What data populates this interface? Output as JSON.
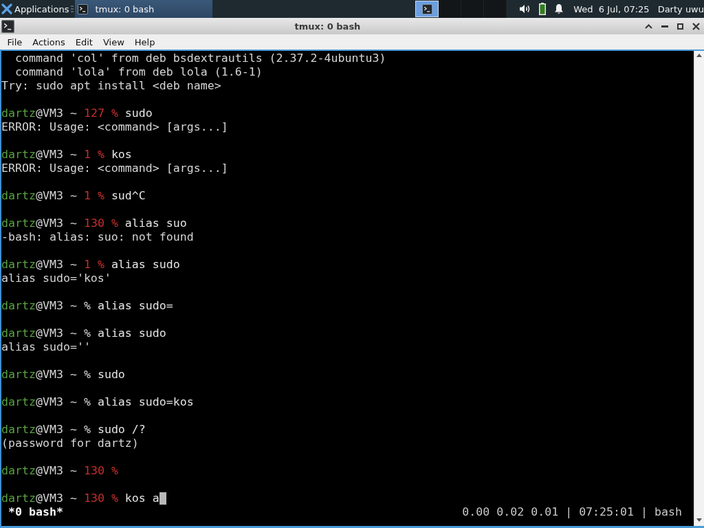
{
  "panel": {
    "applications_button": "Applications",
    "tasks": [
      {
        "label": "tmux: 0 bash",
        "selected": true
      }
    ],
    "workspaces": [
      {
        "selected": true,
        "has_window": true
      },
      {
        "selected": false,
        "has_window": false
      },
      {
        "selected": false,
        "has_window": false
      },
      {
        "selected": false,
        "has_window": false
      }
    ],
    "clock": "Wed  6 Jul, 07:25",
    "user": "Darty uwu"
  },
  "window": {
    "title": "tmux: 0 bash",
    "menu": [
      "File",
      "Actions",
      "Edit",
      "View",
      "Help"
    ]
  },
  "terminal": {
    "lines": [
      {
        "kind": "output",
        "text": "  command 'col' from deb bsdextrautils (2.37.2-4ubuntu3)"
      },
      {
        "kind": "output",
        "text": "  command 'lola' from deb lola (1.6-1)"
      },
      {
        "kind": "output",
        "text": "Try: sudo apt install <deb name>"
      },
      {
        "kind": "blank"
      },
      {
        "kind": "prompt",
        "user": "dartz",
        "host": "@VM3 ~",
        "exit_code": "127",
        "sign": "%",
        "command": "sudo",
        "cursor": false
      },
      {
        "kind": "output",
        "text": "ERROR: Usage: <command> [args...]"
      },
      {
        "kind": "blank"
      },
      {
        "kind": "prompt",
        "user": "dartz",
        "host": "@VM3 ~",
        "exit_code": "1",
        "sign": "%",
        "command": "kos",
        "cursor": false
      },
      {
        "kind": "output",
        "text": "ERROR: Usage: <command> [args...]"
      },
      {
        "kind": "blank"
      },
      {
        "kind": "prompt",
        "user": "dartz",
        "host": "@VM3 ~",
        "exit_code": "1",
        "sign": "%",
        "command": "sud^C",
        "cursor": false
      },
      {
        "kind": "blank"
      },
      {
        "kind": "prompt",
        "user": "dartz",
        "host": "@VM3 ~",
        "exit_code": "130",
        "sign": "%",
        "command": "alias suo",
        "cursor": false
      },
      {
        "kind": "output",
        "text": "-bash: alias: suo: not found"
      },
      {
        "kind": "blank"
      },
      {
        "kind": "prompt",
        "user": "dartz",
        "host": "@VM3 ~",
        "exit_code": "1",
        "sign": "%",
        "command": "alias sudo",
        "cursor": false
      },
      {
        "kind": "output",
        "text": "alias sudo='kos'"
      },
      {
        "kind": "blank"
      },
      {
        "kind": "prompt",
        "user": "dartz",
        "host": "@VM3 ~",
        "sign": "%",
        "command": "alias sudo=",
        "cursor": false
      },
      {
        "kind": "blank"
      },
      {
        "kind": "prompt",
        "user": "dartz",
        "host": "@VM3 ~",
        "sign": "%",
        "command": "alias sudo",
        "cursor": false
      },
      {
        "kind": "output",
        "text": "alias sudo=''"
      },
      {
        "kind": "blank"
      },
      {
        "kind": "prompt",
        "user": "dartz",
        "host": "@VM3 ~",
        "sign": "%",
        "command": "sudo",
        "cursor": false
      },
      {
        "kind": "blank"
      },
      {
        "kind": "prompt",
        "user": "dartz",
        "host": "@VM3 ~",
        "sign": "%",
        "command": "alias sudo=kos",
        "cursor": false
      },
      {
        "kind": "blank"
      },
      {
        "kind": "prompt",
        "user": "dartz",
        "host": "@VM3 ~",
        "sign": "%",
        "command": "sudo /?",
        "cursor": false
      },
      {
        "kind": "output",
        "text": "(password for dartz)"
      },
      {
        "kind": "blank"
      },
      {
        "kind": "prompt",
        "user": "dartz",
        "host": "@VM3 ~",
        "exit_code": "130",
        "sign": "%",
        "cursor": false
      },
      {
        "kind": "blank"
      },
      {
        "kind": "prompt",
        "user": "dartz",
        "host": "@VM3 ~",
        "exit_code": "130",
        "sign": "%",
        "command": "kos a",
        "cursor": true
      }
    ],
    "status_bar": {
      "window_tab": "*0 bash*",
      "info": "0.00 0.02 0.01 | 07:25:01 | bash"
    }
  }
}
